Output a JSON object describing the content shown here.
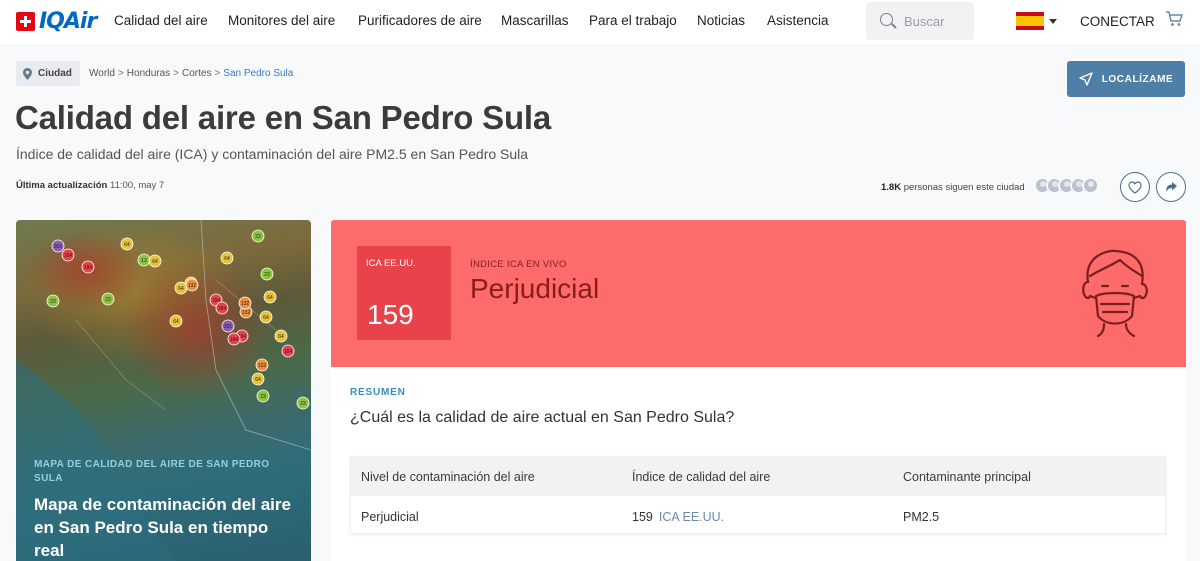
{
  "header": {
    "logo_text": "IQAir",
    "nav": [
      "Calidad del aire",
      "Monitores del aire",
      "Purificadores de aire",
      "Mascarillas",
      "Para el trabajo",
      "Noticias",
      "Asistencia"
    ],
    "search_placeholder": "Buscar",
    "connect_label": "CONECTAR",
    "language": "Español"
  },
  "breadcrumb": {
    "badge": "Ciudad",
    "items": [
      "World",
      "Honduras",
      "Cortes",
      "San Pedro Sula"
    ]
  },
  "locate_label": "LOCALÍZAME",
  "page": {
    "title": "Calidad del aire en San Pedro Sula",
    "subtitle": "Índice de calidad del aire (ICA) y contaminación del aire PM2.5 en San Pedro Sula",
    "updated_label": "Última actualización",
    "updated_value": "11:00, may 7",
    "followers_count": "1.8K",
    "followers_text": "personas siguen este ciudad"
  },
  "map_card": {
    "label": "MAPA DE CALIDAD DEL AIRE DE SAN PEDRO SULA",
    "title": "Mapa de contaminación del aire en San Pedro Sula en tiempo real",
    "markers": [
      "301",
      "184",
      "184",
      "64",
      "13",
      "64",
      "23",
      "23",
      "23",
      "64",
      "64",
      "23",
      "64",
      "132",
      "64",
      "184",
      "132",
      "64",
      "184",
      "301",
      "184",
      "132",
      "64",
      "64",
      "184",
      "184",
      "132",
      "64",
      "23",
      "23"
    ]
  },
  "aqi": {
    "box_label": "ICA EE.UU.",
    "value": "159",
    "live_label": "ÍNDICE ICA EN VIVO",
    "status": "Perjudicial",
    "color": "#fd6b6b"
  },
  "summary": {
    "label": "RESUMEN",
    "question": "¿Cuál es la calidad de aire actual en San Pedro Sula?",
    "headers": [
      "Nivel de contaminación del aire",
      "Índice de calidad del aire",
      "Contaminante principal"
    ],
    "row": {
      "level": "Perjudicial",
      "index": "159",
      "index_unit": "ICA EE.UU.",
      "pollutant": "PM2.5"
    }
  }
}
